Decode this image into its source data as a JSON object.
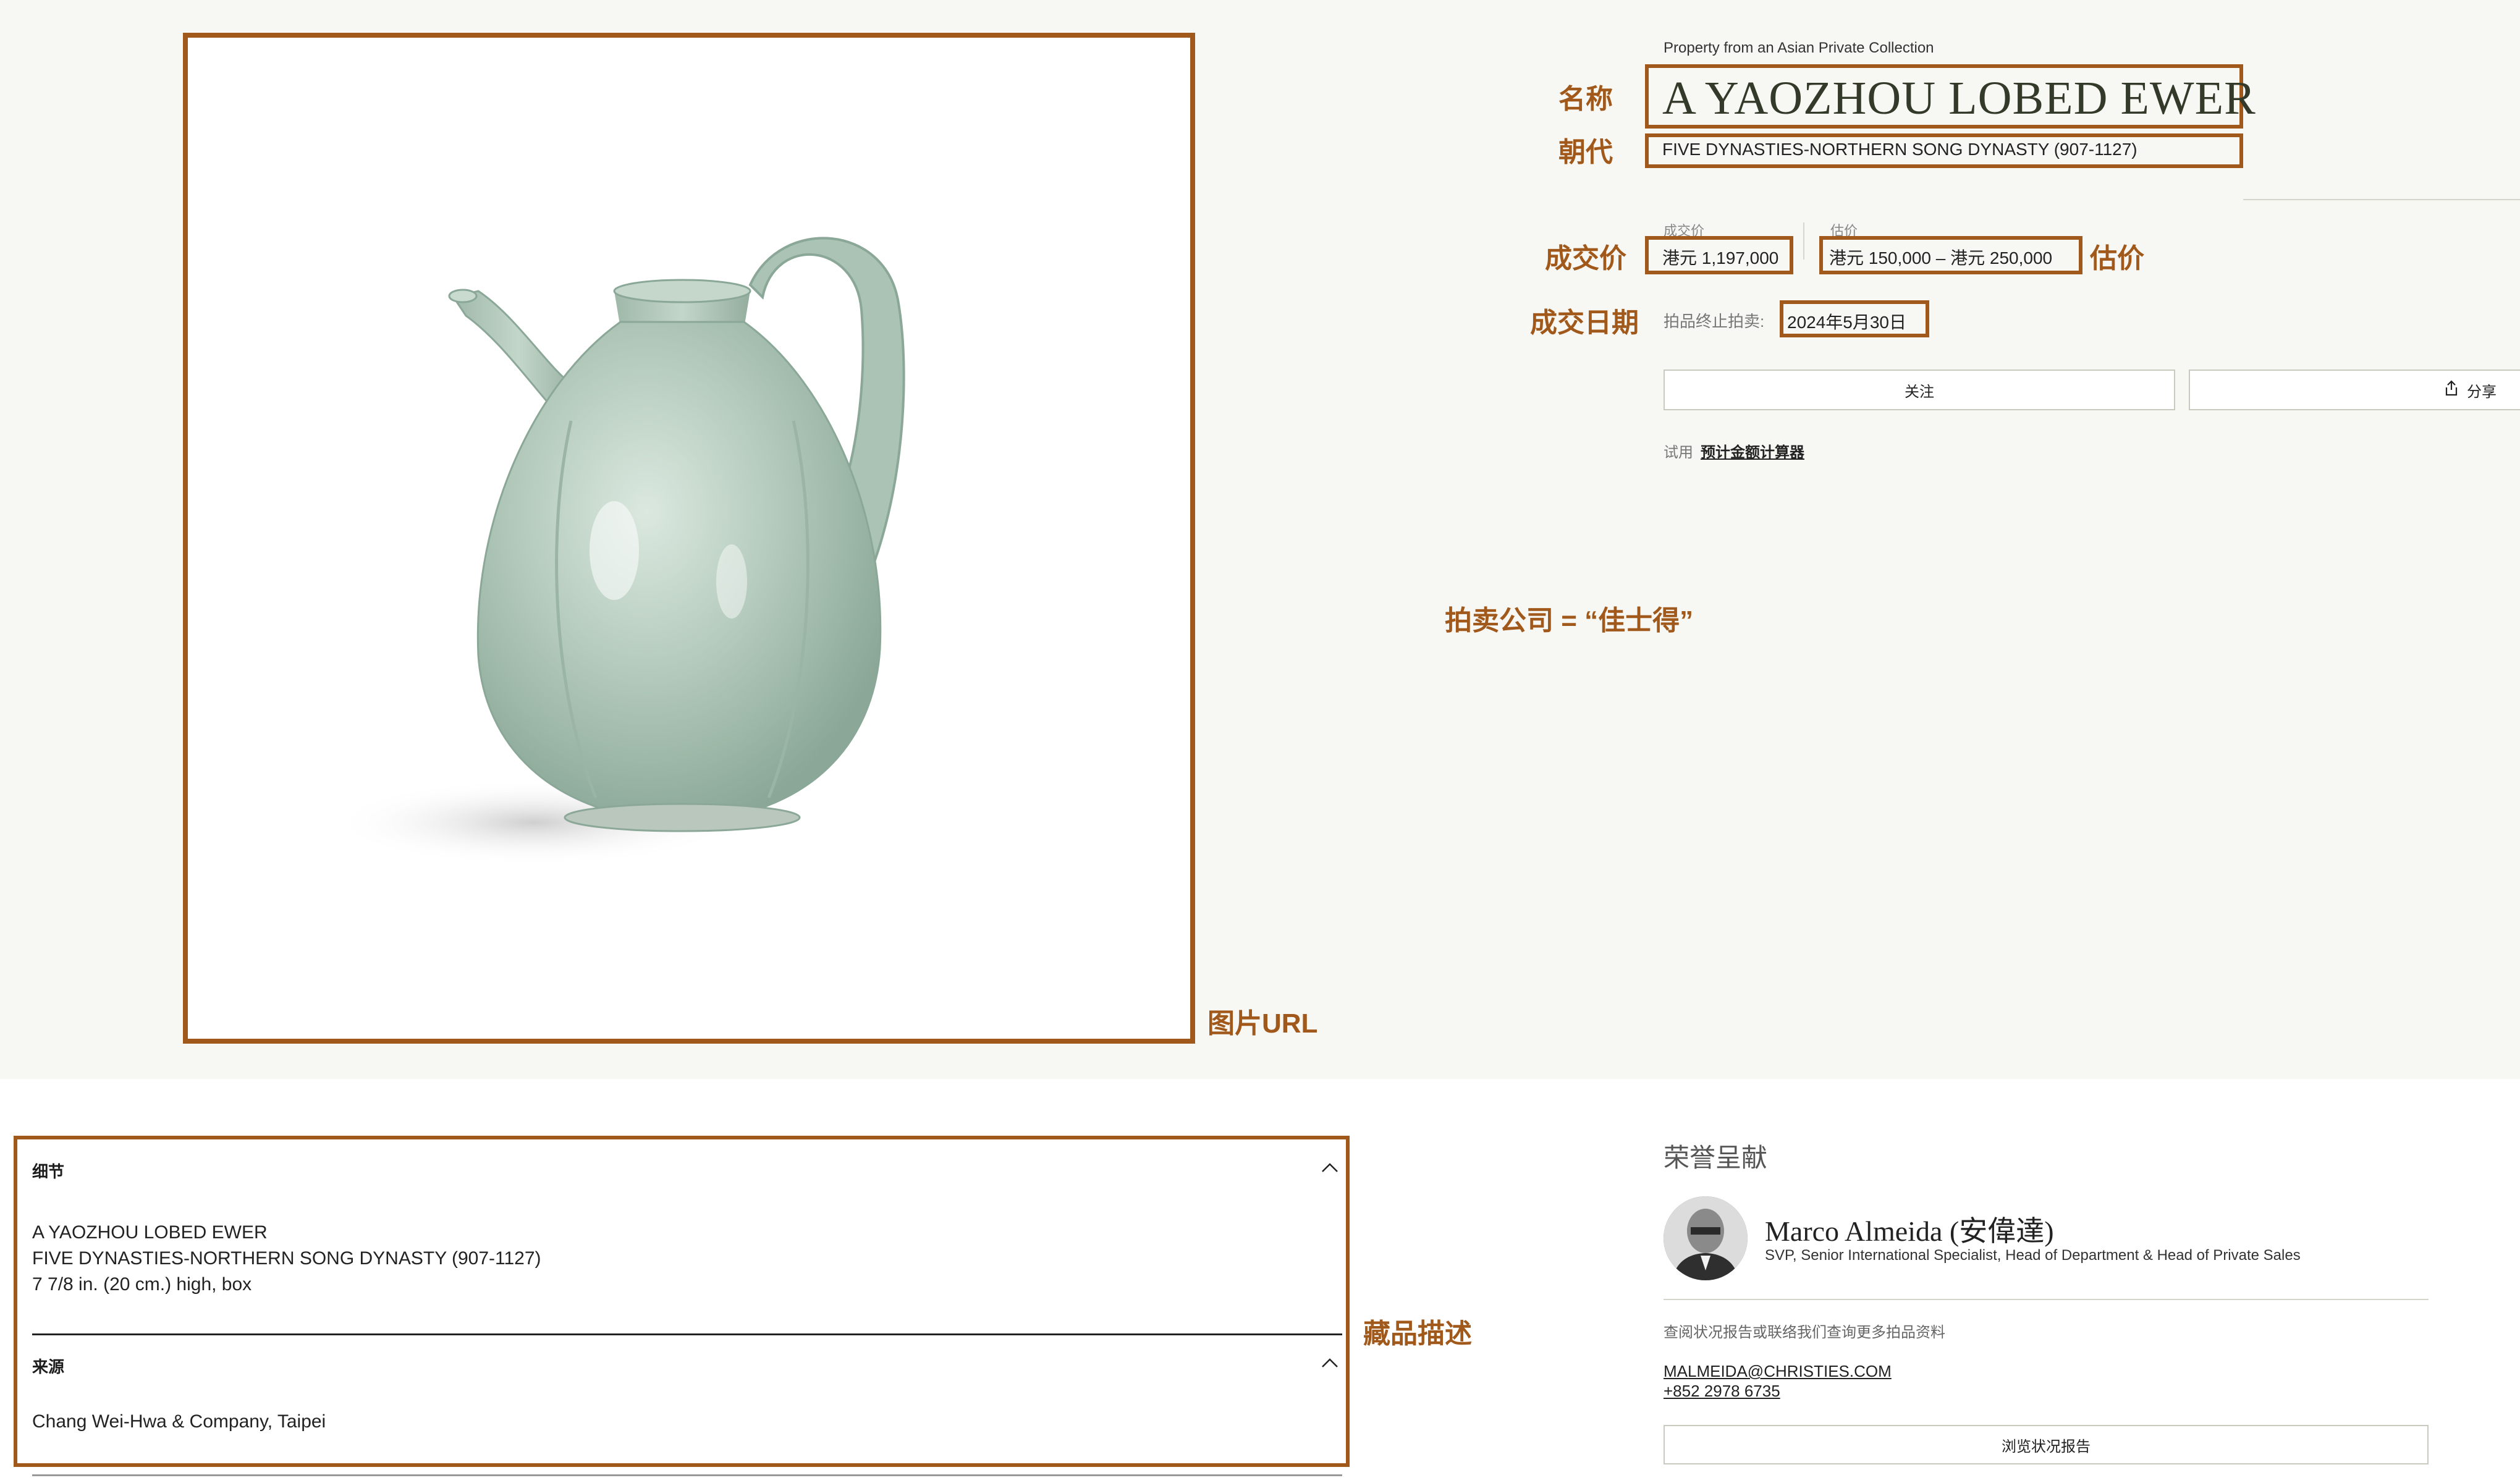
{
  "lot": {
    "provenance_line": "Property from an Asian Private Collection",
    "title": "A YAOZHOU LOBED EWER",
    "dynasty": "FIVE DYNASTIES-NORTHERN SONG DYNASTY (907-1127)",
    "price_realised_label": "成交价",
    "price_realised": "港元 1,197,000",
    "estimate_label": "估价",
    "estimate": "港元 150,000 – 港元 250,000",
    "closed_label": "拍品终止拍卖:",
    "closed_date": "2024年5月30日",
    "follow_button": "关注",
    "share_button": "分享",
    "try_label": "试用",
    "calculator_link": "预计金额计算器"
  },
  "annotations": {
    "name": "名称",
    "dynasty": "朝代",
    "price": "成交价",
    "estimate": "估价",
    "date": "成交日期",
    "auction_house": "拍卖公司 = “佳士得”",
    "image_url": "图片URL",
    "description": "藏品描述"
  },
  "details": {
    "details_header": "细节",
    "lines": [
      "A YAOZHOU LOBED EWER",
      "FIVE DYNASTIES-NORTHERN SONG DYNASTY (907-1127)",
      "7 7/8 in. (20 cm.) high, box"
    ],
    "provenance_header": "来源",
    "provenance_text": "Chang Wei-Hwa & Company, Taipei"
  },
  "specialist": {
    "section_title": "荣誉呈献",
    "name": "Marco Almeida (安偉達)",
    "role": "SVP, Senior International Specialist, Head of Department & Head of Private Sales",
    "contact_prompt": "查阅状况报告或联络我们查询更多拍品资料",
    "email": "MALMEIDA@CHRISTIES.COM",
    "phone": "+852 2978 6735",
    "condition_report_button": "浏览状况报告"
  },
  "colors": {
    "annotation": "#a1591b",
    "background": "#f7f7f3",
    "celadon": "#a9c2b3"
  },
  "icons": [
    "share-icon",
    "chevron-up-icon",
    "avatar"
  ]
}
